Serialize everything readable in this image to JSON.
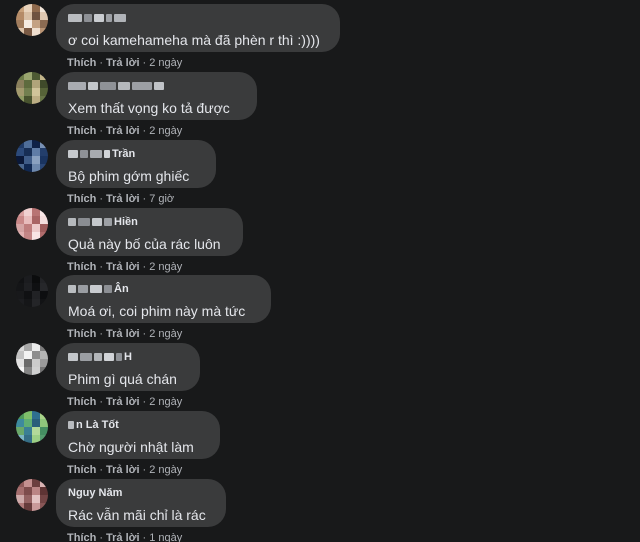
{
  "labels": {
    "like": "Thích",
    "reply": "Trả lời",
    "separator": "·"
  },
  "comments": [
    {
      "author": "",
      "text": "ơ coi kamehameha mà đã phèn r thì :))))",
      "time": "2 ngày"
    },
    {
      "author": "",
      "text": "Xem thất vọng ko tả được",
      "time": "2 ngày"
    },
    {
      "author": "Trần",
      "text": "Bộ phim gớm ghiếc",
      "time": "7 giờ"
    },
    {
      "author": "Hiền",
      "text": "Quả này bố của rác luôn",
      "time": "2 ngày"
    },
    {
      "author": "Ân",
      "text": "Moá ơi, coi phim này mà tức",
      "time": "2 ngày"
    },
    {
      "author": "H",
      "text": "Phim gì quá chán",
      "time": "2 ngày"
    },
    {
      "author": "n Là  Tốt",
      "text": "Chờ người nhật làm",
      "time": "2 ngày"
    },
    {
      "author": "Nguy  Năm",
      "text": "Rác vẫn mãi chỉ là rác",
      "time": "1 ngày"
    }
  ]
}
